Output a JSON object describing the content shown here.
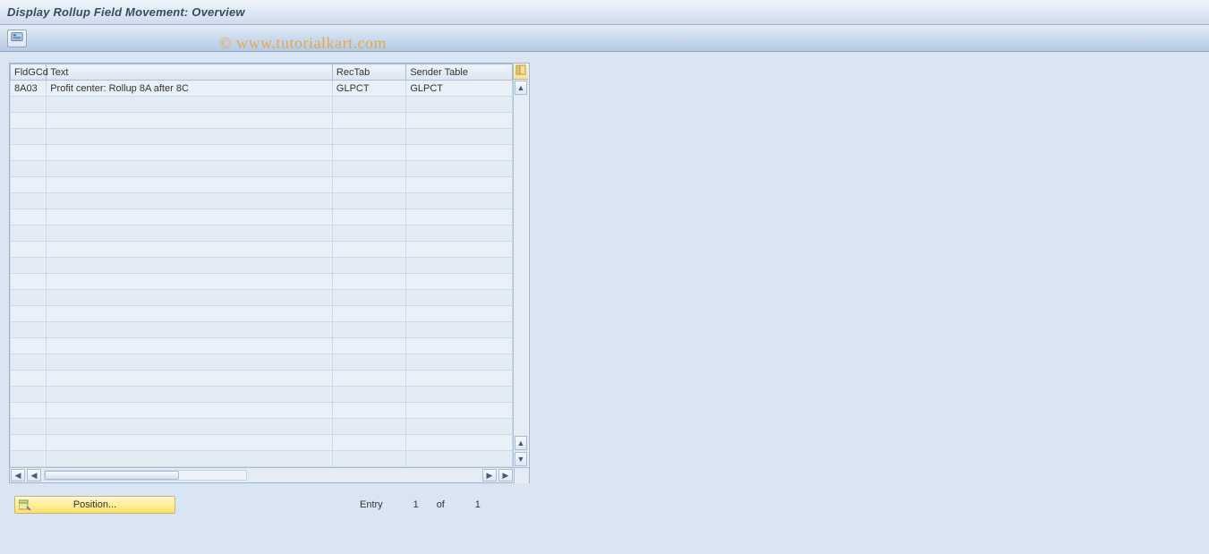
{
  "header": {
    "title": "Display Rollup Field Movement: Overview"
  },
  "toolbar": {
    "icon_name": "overview-icon"
  },
  "watermark": "© www.tutorialkart.com",
  "table": {
    "columns": {
      "fldgcd": "FldGCd",
      "text": "Text",
      "rectab": "RecTab",
      "sender": "Sender Table"
    },
    "rows": [
      {
        "fldgcd": "8A03",
        "text": "Profit center: Rollup 8A after 8C",
        "rectab": "GLPCT",
        "sender": "GLPCT"
      }
    ],
    "empty_row_count": 23
  },
  "footer": {
    "position_button": "Position...",
    "entry_label": "Entry",
    "entry_current": "1",
    "entry_of": "of",
    "entry_total": "1"
  }
}
